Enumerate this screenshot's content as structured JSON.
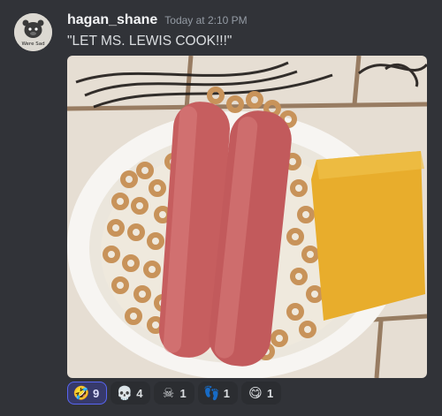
{
  "message": {
    "username": "hagan_shane",
    "timestamp": "Today at 2:10 PM",
    "text": "\"LET MS. LEWIS COOK!!!\"",
    "avatar": {
      "caption": "Were Sad",
      "icon": "cartoon-bear-avatar"
    },
    "attachment": {
      "icon": "image-photo",
      "alt": "Image attachment"
    }
  },
  "reactions": [
    {
      "icon": "rolling-on-floor-laughing-icon",
      "glyph": "🤣",
      "count": "9",
      "active": true
    },
    {
      "icon": "skull-icon",
      "glyph": "💀",
      "count": "4",
      "active": false
    },
    {
      "icon": "skull-and-crossbones-icon",
      "glyph": "☠",
      "count": "1",
      "active": false
    },
    {
      "icon": "footprints-icon",
      "glyph": "👣",
      "count": "1",
      "active": false
    },
    {
      "icon": "face-savoring-food-icon",
      "glyph": "😋",
      "count": "1",
      "active": false
    }
  ],
  "colors": {
    "background": "#313338",
    "username": "#f2f3f5",
    "timestamp": "#949ba4",
    "active_reaction_border": "#5865f2"
  }
}
